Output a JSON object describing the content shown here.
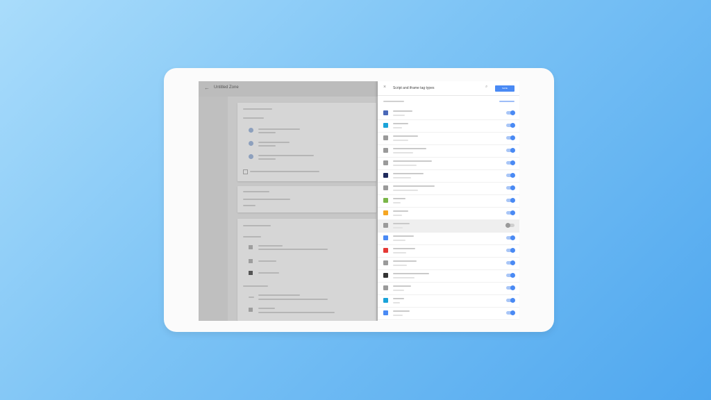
{
  "header": {
    "left_title": "Untitled Zone",
    "right_title": "Script and iframe tag types",
    "save_label": "SAVE"
  },
  "accent": "#4a8af4",
  "tag_rows": [
    {
      "icon": "tag-type-icon",
      "color": "#4a68b8",
      "on": true
    },
    {
      "icon": "tag-type-icon",
      "color": "#1aa3d9",
      "on": true
    },
    {
      "icon": "tag-type-icon",
      "color": "#9a9a9a",
      "on": true
    },
    {
      "icon": "tag-type-icon",
      "color": "#9a9a9a",
      "on": true
    },
    {
      "icon": "tag-type-icon",
      "color": "#9a9a9a",
      "on": true
    },
    {
      "icon": "tag-type-icon",
      "color": "#1f2a5c",
      "on": true
    },
    {
      "icon": "tag-type-icon",
      "color": "#9a9a9a",
      "on": true
    },
    {
      "icon": "tag-type-icon",
      "color": "#7ab648",
      "on": true
    },
    {
      "icon": "tag-type-icon",
      "color": "#f5a623",
      "on": true
    },
    {
      "icon": "custom-html-icon",
      "color": "#9a9a9a",
      "on": false
    },
    {
      "icon": "tag-type-icon",
      "color": "#4a8af4",
      "on": true
    },
    {
      "icon": "tag-type-icon",
      "color": "#e53935",
      "on": true
    },
    {
      "icon": "tag-type-icon",
      "color": "#9a9a9a",
      "on": true
    },
    {
      "icon": "tag-type-icon",
      "color": "#333333",
      "on": true
    },
    {
      "icon": "tag-type-icon",
      "color": "#9a9a9a",
      "on": true
    },
    {
      "icon": "tag-type-icon",
      "color": "#1aa3d9",
      "on": true
    },
    {
      "icon": "tag-type-icon",
      "color": "#4a8af4",
      "on": true
    }
  ]
}
